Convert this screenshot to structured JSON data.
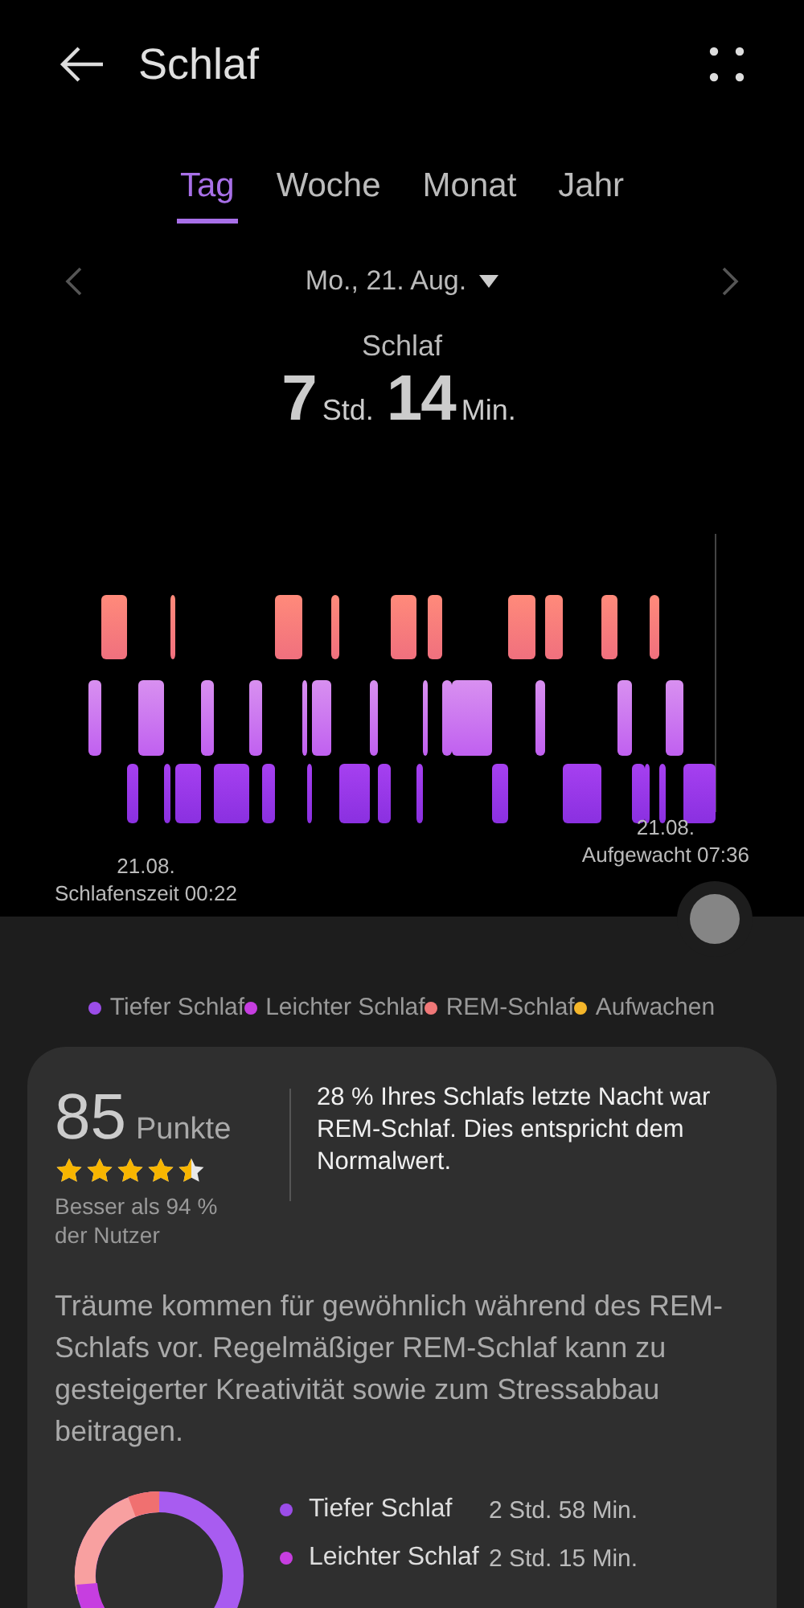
{
  "header": {
    "title": "Schlaf"
  },
  "tabs": [
    {
      "label": "Tag",
      "selected": true
    },
    {
      "label": "Woche",
      "selected": false
    },
    {
      "label": "Monat",
      "selected": false
    },
    {
      "label": "Jahr",
      "selected": false
    }
  ],
  "date": {
    "label": "Mo., 21. Aug."
  },
  "summary": {
    "label": "Schlaf",
    "hours": "7",
    "hours_unit": "Std.",
    "minutes": "14",
    "minutes_unit": "Min."
  },
  "chart": {
    "start_date": "21.08.",
    "start_label": "Schlafenszeit 00:22",
    "end_date": "21.08.",
    "end_label": "Aufgewacht 07:36"
  },
  "legend": [
    {
      "label": "Tiefer Schlaf",
      "color": "#9b4de8"
    },
    {
      "label": "Leichter Schlaf",
      "color": "#c63ee0"
    },
    {
      "label": "REM-Schlaf",
      "color": "#f07878"
    },
    {
      "label": "Aufwachen",
      "color": "#f5b62a"
    }
  ],
  "score": {
    "value": "85",
    "unit": "Punkte",
    "stars": 4.5,
    "comparison": "Besser als 94 % der Nutzer",
    "note": "28 % Ihres Schlafs letzte Nacht war REM-Schlaf. Dies entspricht dem Normalwert."
  },
  "description": "Träume kommen für gewöhnlich während des REM-Schlafs vor. Regelmäßiger REM-Schlaf kann zu gesteigerter Kreativität sowie zum Stressabbau beitragen.",
  "breakdown": [
    {
      "label": "Tiefer Schlaf",
      "color": "#9b4de8",
      "duration": "2 Std. 58 Min."
    },
    {
      "label": "Leichter Schlaf",
      "color": "#c63ee0",
      "duration": "2 Std. 15 Min."
    }
  ]
}
